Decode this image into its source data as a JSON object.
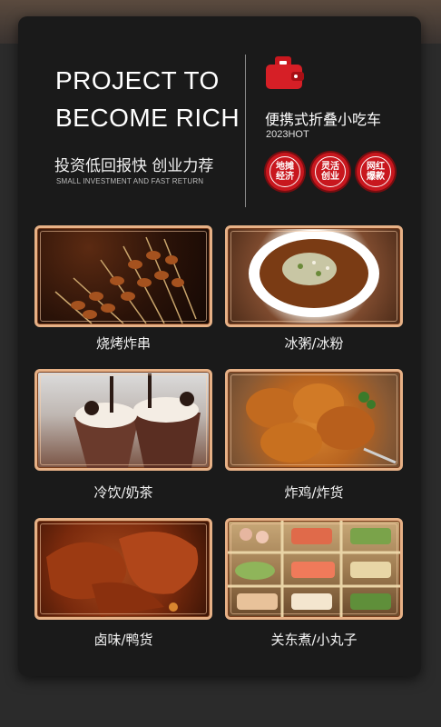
{
  "header": {
    "headline_line1": "PROJECT TO",
    "headline_line2": "BECOME RICH",
    "tagline": "投资低回报快 创业力荐",
    "subtag": "SMALL INVESTMENT AND FAST RETURN"
  },
  "product": {
    "title": "便携式折叠小吃车",
    "year": "2023HOT",
    "icon": "wallet-icon",
    "accent_color": "#c8171e"
  },
  "badges": [
    {
      "line1": "地摊",
      "line2": "经济"
    },
    {
      "line1": "灵活",
      "line2": "创业"
    },
    {
      "line1": "网红",
      "line2": "爆款"
    }
  ],
  "items": [
    {
      "label": "烧烤炸串"
    },
    {
      "label": "冰粥/冰粉"
    },
    {
      "label": "冷饮/奶茶"
    },
    {
      "label": "炸鸡/炸货"
    },
    {
      "label": "卤味/鸭货"
    },
    {
      "label": "关东煮/小丸子"
    }
  ]
}
